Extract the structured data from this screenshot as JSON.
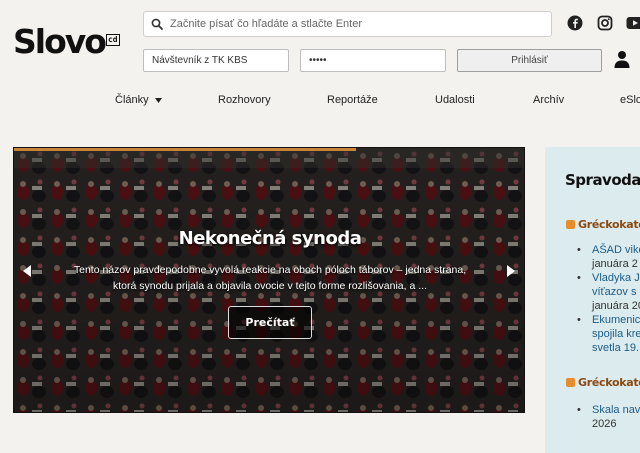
{
  "logo": {
    "text": "Slovo",
    "badge": "cd"
  },
  "search": {
    "placeholder": "Začnite písať čo hľadáte a stlačte Enter"
  },
  "login": {
    "username_value": "Návštevník z TK KBS",
    "password_value": "•••••",
    "button_label": "Prihlásiť"
  },
  "social": [
    "facebook-icon",
    "instagram-icon",
    "youtube-icon"
  ],
  "nav": {
    "items": [
      {
        "label": "Články",
        "has_dropdown": true
      },
      {
        "label": "Rozhovory"
      },
      {
        "label": "Reportáže"
      },
      {
        "label": "Udalosti"
      },
      {
        "label": "Archív"
      },
      {
        "label": "eSlo"
      }
    ]
  },
  "hero": {
    "title": "Nekonečná synoda",
    "text": "Tento názov pravdepodobne vyvolá reakcie na oboch póloch táborov – jedna strana, ktorá synodu prijala a objavila ovocie v tejto forme rozlišovania, a ...",
    "button_label": "Prečítať",
    "accent_color": "#c8853a"
  },
  "sidebar": {
    "title": "Spravoda",
    "feeds": [
      {
        "heading": "Gréckokatol",
        "items": [
          {
            "lines": [
              "AŠAD vike",
              "januára 2"
            ]
          },
          {
            "lines": [
              "Vladyka J",
              "víťazov s",
              "januára 20"
            ]
          },
          {
            "lines": [
              "Ekumenic",
              "spojila kre",
              "svetla 19. "
            ]
          }
        ]
      },
      {
        "heading": "Gréckokatol",
        "items": [
          {
            "lines": [
              "Skala nav",
              "2026"
            ]
          }
        ]
      }
    ]
  }
}
